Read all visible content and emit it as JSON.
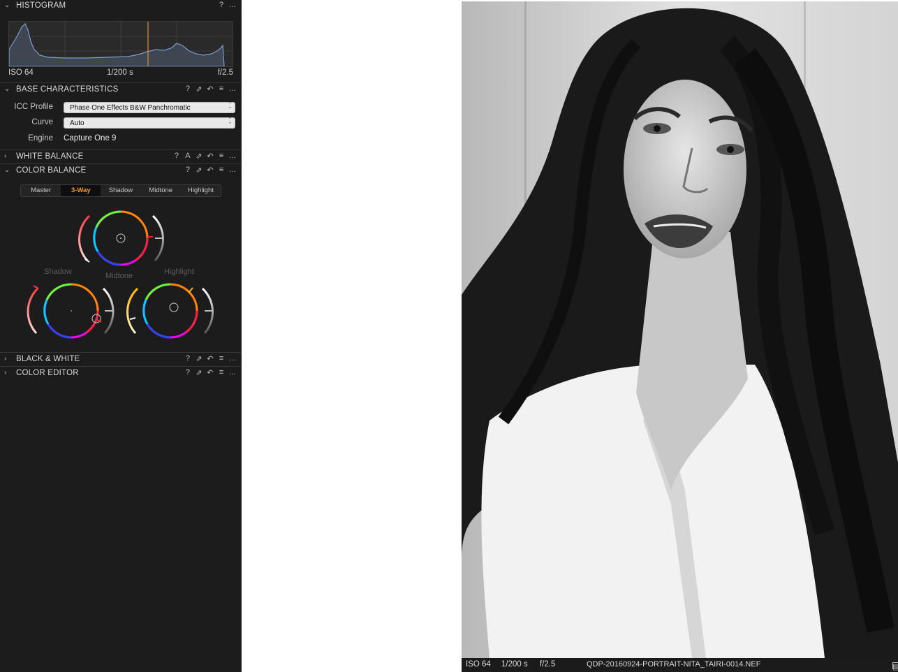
{
  "histogram": {
    "title": "HISTOGRAM",
    "iso": "ISO 64",
    "shutter": "1/200 s",
    "aperture": "f/2.5",
    "header_icons": [
      "?",
      "..."
    ]
  },
  "base_characteristics": {
    "title": "BASE CHARACTERISTICS",
    "icc_label": "ICC Profile",
    "icc_value": "Phase One Effects  B&W Panchromatic",
    "curve_label": "Curve",
    "curve_value": "Auto",
    "engine_label": "Engine",
    "engine_value": "Capture One 9"
  },
  "white_balance": {
    "title": "WHITE BALANCE"
  },
  "color_balance": {
    "title": "COLOR BALANCE",
    "tabs": [
      "Master",
      "3-Way",
      "Shadow",
      "Midtone",
      "Highlight"
    ],
    "active_tab": "3-Way",
    "shadow_label": "Shadow",
    "midtone_label": "Midtone",
    "highlight_label": "Highlight"
  },
  "black_white": {
    "title": "BLACK & WHITE"
  },
  "color_editor": {
    "title": "COLOR EDITOR"
  },
  "icons": {
    "help": "?",
    "auto": "A",
    "copy": "copy-apply-icon",
    "reset": "reset-icon",
    "presets": "presets-menu-icon",
    "more": "..."
  },
  "viewer": {
    "iso": "ISO 64",
    "shutter": "1/200 s",
    "aperture": "f/2.5",
    "filename": "QDP-20160924-PORTRAIT-NITA_TAIRI-0014.NEF"
  },
  "colors": {
    "panel_bg": "#1c1c1c",
    "accent": "#f19a2b",
    "histogram_line": "#6f8fbf",
    "histogram_marker": "#e08a2c"
  }
}
